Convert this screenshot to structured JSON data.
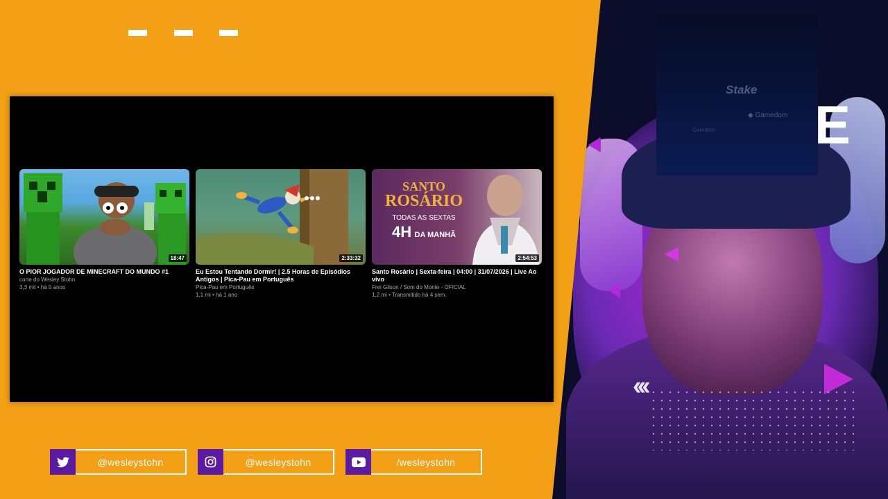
{
  "videos": [
    {
      "title": "O PIOR JOGADOR DE MINECRAFT DO MUNDO #1",
      "channel": "corte do Wesley Stohn",
      "meta": "3,3 mil • há 5 anos",
      "duration": "18:47"
    },
    {
      "title": "Eu Estou Tentando Dormir! | 2.5 Horas de Episódios Antigos | Pica-Pau em Português",
      "channel": "Pica-Pau em Português",
      "meta": "1,1 mi • há 1 ano",
      "duration": "2:33:32"
    },
    {
      "title": "Santo Rosário | Sexta-feira | 04:00 | 31/07/2026 | Live Ao vivo",
      "channel": "Frei Gilson / Som do Monte - OFICIAL",
      "meta": "1,2 mi • Transmitido há 4 sem.",
      "duration": "2:54:53",
      "thumb_text": {
        "line1": "SANTO",
        "line2": "ROSÁRIO",
        "line3": "TODAS AS SEXTAS",
        "line4a": "4H",
        "line4b": "DA MANHÃ"
      }
    }
  ],
  "sponsor": {
    "brand1": "Stake",
    "brand2": "Gamedom",
    "brand3": "Gamdom"
  },
  "hero": {
    "letter": "E"
  },
  "social": [
    {
      "handle": "@wesleystohn",
      "icon": "twitter-icon"
    },
    {
      "handle": "@wesleystohn",
      "icon": "instagram-icon"
    },
    {
      "handle": "/wesleystohn",
      "icon": "youtube-icon"
    }
  ],
  "colors": {
    "background": "#f3a017",
    "accent_purple": "#5a1aa2",
    "panel": "#000000"
  }
}
